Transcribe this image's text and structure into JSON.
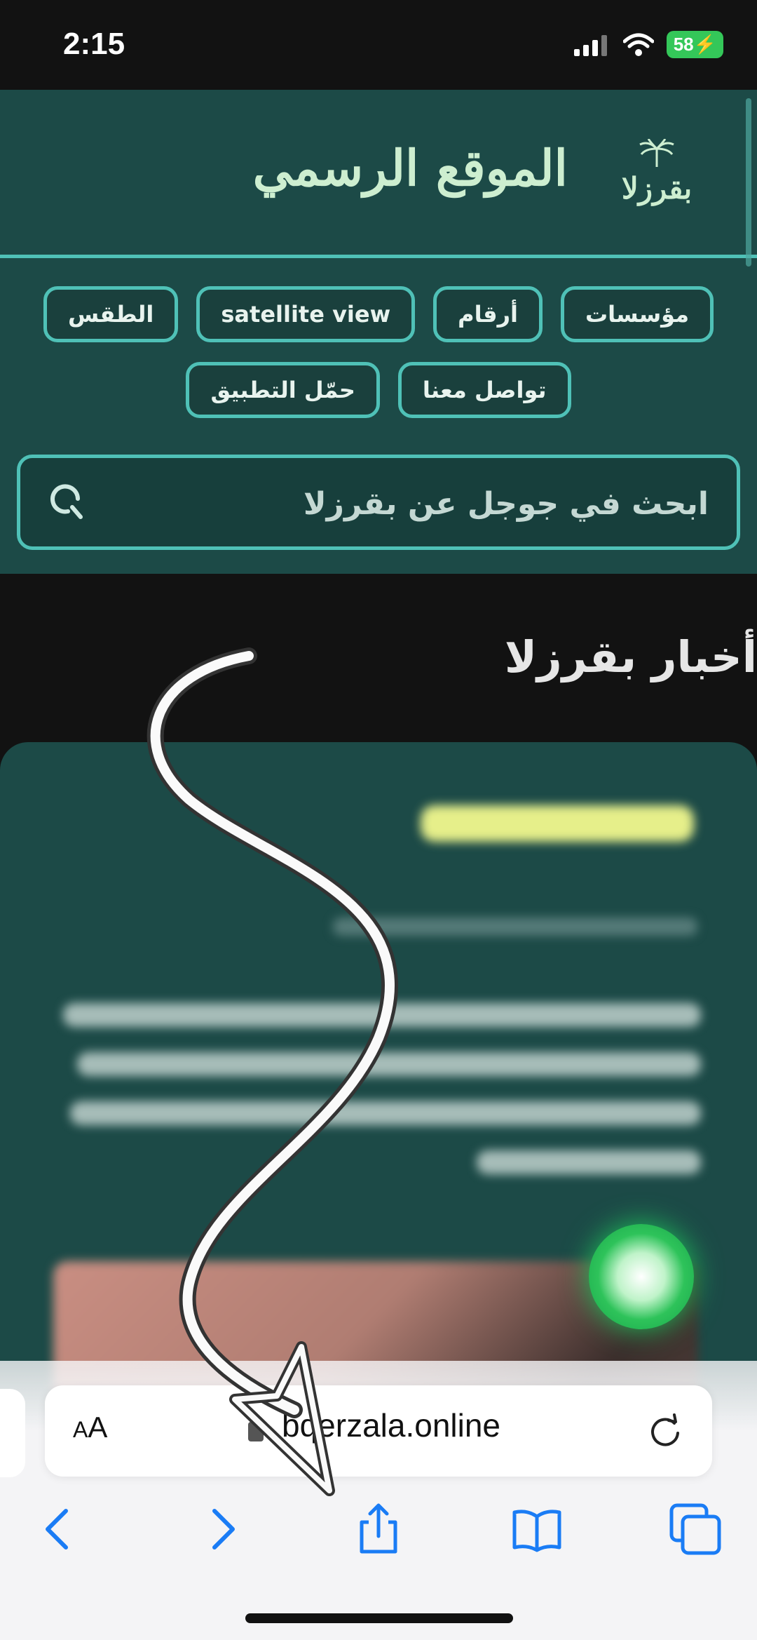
{
  "status_bar": {
    "time": "2:15",
    "battery": "58",
    "icons": [
      "signal-icon",
      "wifi-icon",
      "battery-charging-icon"
    ]
  },
  "header": {
    "title": "الموقع الرسمي",
    "logo_text": "بقرزلا"
  },
  "nav": {
    "row1": [
      "مؤسسات",
      "أرقام",
      "satellite view",
      "الطقس"
    ],
    "row2": [
      "تواصل معنا",
      "حمّل التطبيق"
    ]
  },
  "search": {
    "placeholder": "ابحث في جوجل عن بقرزلا",
    "icon": "search-icon"
  },
  "news": {
    "section_title": "أخبار بقرزلا"
  },
  "browser": {
    "aa_small": "A",
    "aa_large": "A",
    "url": "bqerzala.online"
  },
  "colors": {
    "header_bg": "#1c4a47",
    "accent": "#4fc1b7",
    "title": "#cdeed0",
    "whatsapp": "#25d366"
  }
}
